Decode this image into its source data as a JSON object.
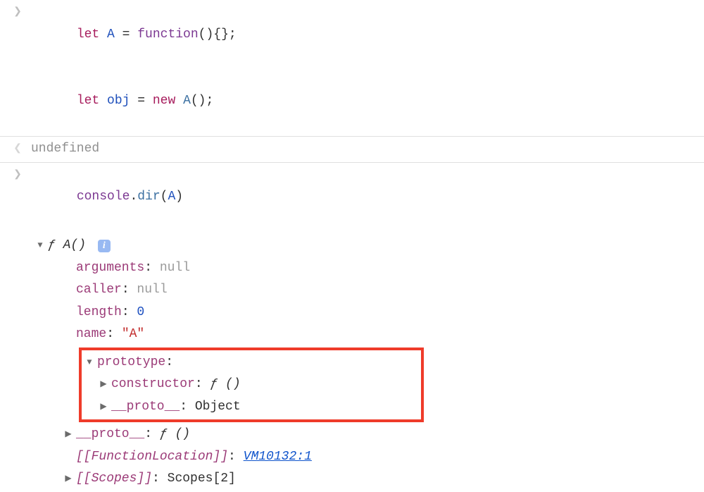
{
  "input1": {
    "line1": {
      "kw_let": "let",
      "id_A": "A",
      "eq": " = ",
      "kw_function": "function",
      "parens": "(){};"
    },
    "line2": {
      "kw_let": "let",
      "id_obj": "obj",
      "eq": " = ",
      "kw_new": "new",
      "fn_A": "A",
      "parens": "();"
    }
  },
  "output1": {
    "text": "undefined"
  },
  "input2": {
    "console": "console",
    "dot": ".",
    "dir": "dir",
    "open": "(",
    "arg": "A",
    "close": ")"
  },
  "tree": {
    "head_f": "ƒ",
    "head_name": " A() ",
    "info": "i",
    "arguments_key": "arguments",
    "arguments_val": "null",
    "caller_key": "caller",
    "caller_val": "null",
    "length_key": "length",
    "length_val": "0",
    "name_key": "name",
    "name_val": "\"A\"",
    "prototype_key": "prototype",
    "constructor_key": "constructor",
    "constructor_val_f": "ƒ ",
    "constructor_val_sig": "()",
    "proto_key": "__proto__",
    "proto_val_obj": "Object",
    "outer_proto_key": "__proto__",
    "outer_proto_val_f": "ƒ ",
    "outer_proto_val_sig": "()",
    "funcloc_key": "[[FunctionLocation]]",
    "funcloc_val": "VM10132:1",
    "scopes_key": "[[Scopes]]",
    "scopes_val": "Scopes[2]"
  }
}
